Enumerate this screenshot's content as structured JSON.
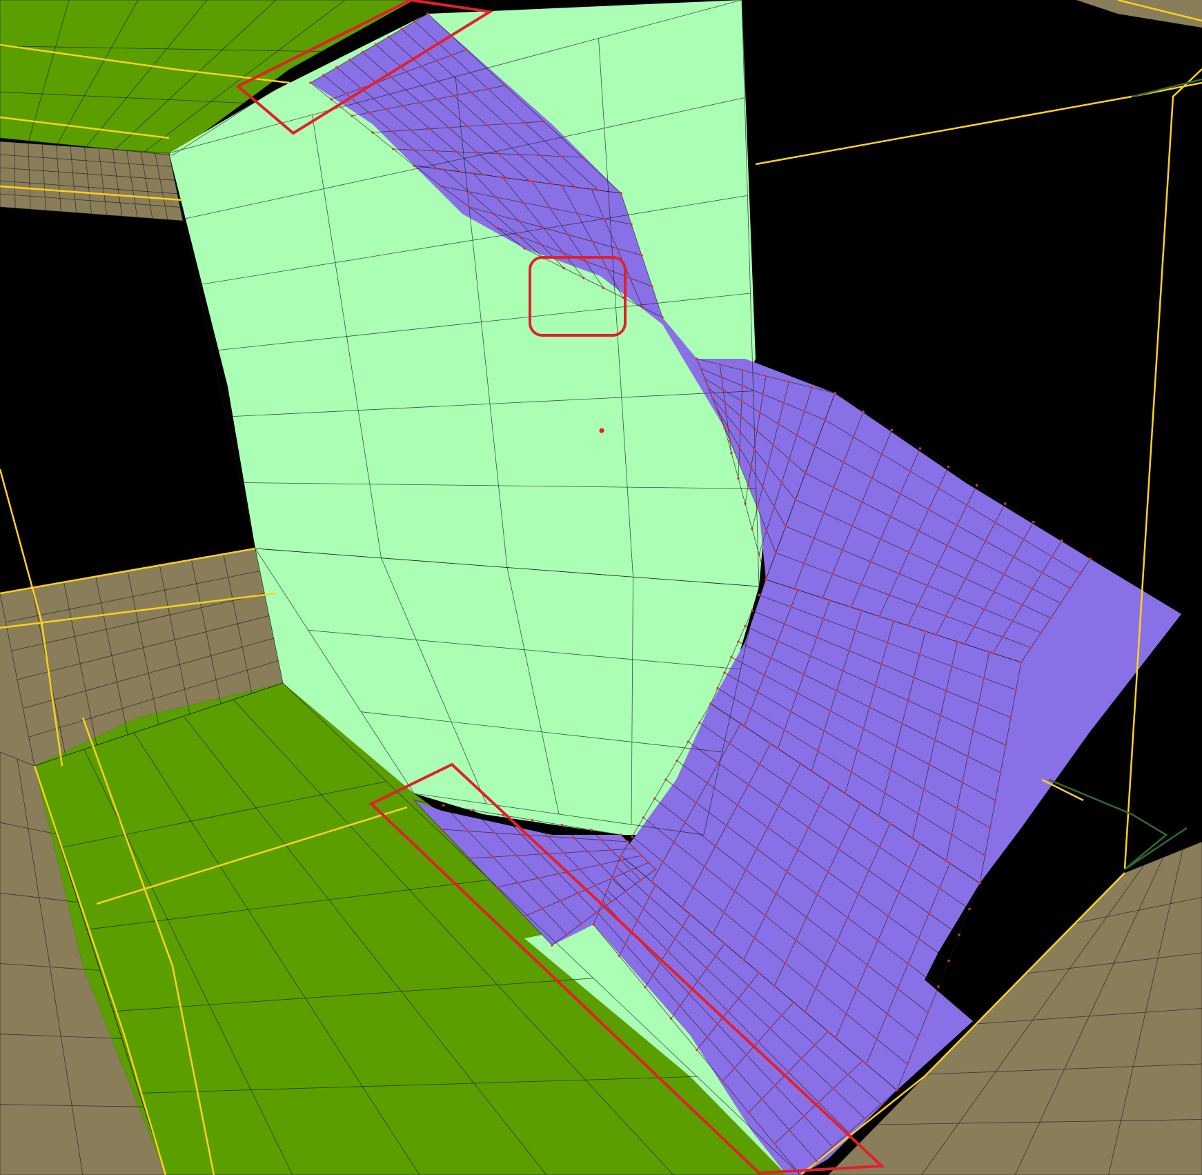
{
  "viewport": {
    "label": "",
    "background": "#000000"
  },
  "colors": {
    "ground_tan": "#8a7e5a",
    "plate_green": "#5a9e00",
    "block_light_green": "#aaffb4",
    "surface_purple": "#8a70e6",
    "edge_yellow": "#ffd21a",
    "highlight_red": "#e3202a",
    "mesh_line": "#1a1a1a",
    "node_red": "#e53040"
  },
  "icons": {
    "highlight_rectangle": "red-rectangle-highlight-icon",
    "highlight_rounded": "red-rounded-square-highlight-icon"
  }
}
